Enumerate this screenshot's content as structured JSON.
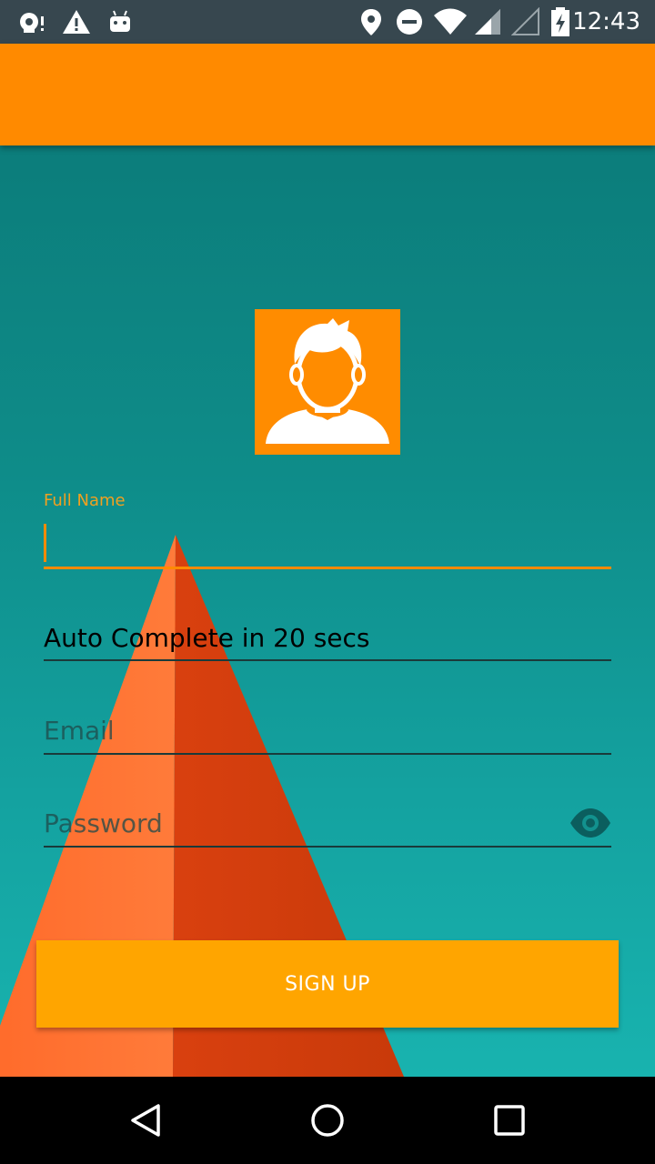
{
  "status_bar": {
    "time": "12:43",
    "left_icons": [
      "podcast-notification-icon",
      "warning-icon",
      "android-debug-icon"
    ],
    "right_icons": [
      "location-icon",
      "do-not-disturb-icon",
      "wifi-icon",
      "cell-signal-icon",
      "cell-signal-no-data-icon",
      "battery-charging-icon"
    ]
  },
  "app_bar": {
    "color": "#FF8A00"
  },
  "avatar": {
    "icon": "user-avatar-icon",
    "background": "#FF8C00"
  },
  "form": {
    "full_name": {
      "label": "Full Name",
      "value": ""
    },
    "auto_complete": {
      "value": "Auto Complete in 20 secs"
    },
    "email": {
      "placeholder": "Email"
    },
    "password": {
      "placeholder": "Password",
      "toggle_icon": "eye-icon"
    }
  },
  "signup_button": {
    "label": "SIGN UP",
    "color": "#FFA500"
  },
  "nav_bar": {
    "buttons": [
      "back-icon",
      "home-icon",
      "recents-icon"
    ]
  }
}
